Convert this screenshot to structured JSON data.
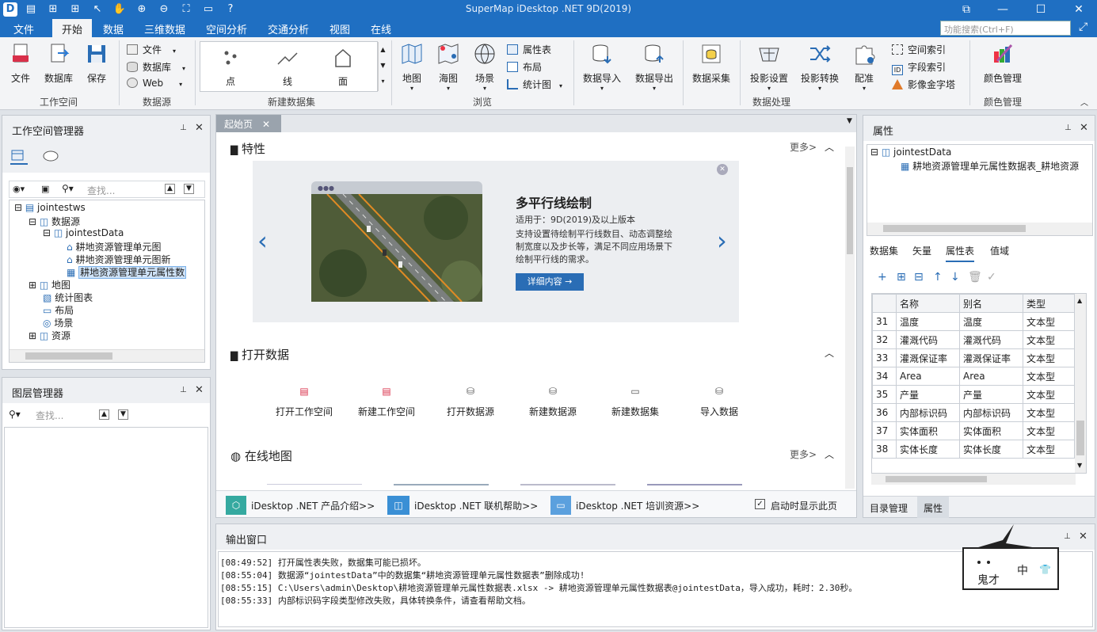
{
  "app_title": "SuperMap iDesktop .NET 9D(2019)",
  "menu": [
    "文件",
    "开始",
    "数据",
    "三维数据",
    "空间分析",
    "交通分析",
    "视图",
    "在线"
  ],
  "search_placeholder": "功能搜索(Ctrl+F)",
  "ribbon": {
    "workspace": {
      "items": [
        "文件",
        "数据库",
        "保存"
      ],
      "group": "工作空间"
    },
    "datasource": {
      "items": [
        "文件",
        "数据库",
        "Web"
      ],
      "group": "数据源"
    },
    "new_dataset": {
      "items": [
        "点",
        "线",
        "面"
      ],
      "group": "新建数据集"
    },
    "browse": {
      "items": [
        "地图",
        "海图",
        "场景"
      ],
      "small": [
        "属性表",
        "布局",
        "统计图"
      ],
      "group": "浏览"
    },
    "data_process": {
      "items": [
        "数据导入",
        "数据导出",
        "数据采集",
        "投影设置",
        "投影转换",
        "配准"
      ],
      "small": [
        "空间索引",
        "字段索引",
        "影像金字塔"
      ],
      "group": "数据处理"
    },
    "color": {
      "items": [
        "颜色管理"
      ],
      "group": "颜色管理"
    }
  },
  "workspace_manager": {
    "title": "工作空间管理器",
    "search_placeholder": "查找...",
    "tree": [
      "jointestws",
      "数据源",
      "jointestData",
      "耕地资源管理单元图",
      "耕地资源管理单元图新",
      "耕地资源管理单元属性数",
      "地图",
      "统计图表",
      "布局",
      "场景",
      "资源"
    ]
  },
  "layer_manager": {
    "title": "图层管理器",
    "search_placeholder": "查找..."
  },
  "start_page": {
    "tab": "起始页",
    "features": {
      "title": "特性",
      "more": "更多>"
    },
    "card": {
      "title": "多平行线绘制",
      "applies": "适用于：9D(2019)及以上版本",
      "desc": [
        "支持设置待绘制平行线数目、动态调整绘",
        "制宽度以及步长等，满足不同应用场景下",
        "绘制平行线的需求。"
      ],
      "button": "详细内容 →"
    },
    "open_data": {
      "title": "打开数据",
      "items": [
        "打开工作空间",
        "新建工作空间",
        "打开数据源",
        "新建数据源",
        "新建数据集",
        "导入数据"
      ]
    },
    "online_map": {
      "title": "在线地图",
      "more": "更多>"
    },
    "footer": {
      "links": [
        "iDesktop .NET 产品介绍>>",
        "iDesktop .NET 联机帮助>>",
        "iDesktop .NET 培训资源>>"
      ],
      "checkbox": "启动时显示此页"
    }
  },
  "properties": {
    "title": "属性",
    "tree": [
      "jointestData",
      "耕地资源管理单元属性数据表_耕地资源"
    ],
    "tabs": [
      "数据集",
      "矢量",
      "属性表",
      "值域"
    ],
    "columns": [
      "名称",
      "别名",
      "类型"
    ],
    "rows": [
      [
        "31",
        "温度",
        "温度",
        "文本型"
      ],
      [
        "32",
        "灌溉代码",
        "灌溉代码",
        "文本型"
      ],
      [
        "33",
        "灌溉保证率",
        "灌溉保证率",
        "文本型"
      ],
      [
        "34",
        "Area",
        "Area",
        "文本型"
      ],
      [
        "35",
        "产量",
        "产量",
        "文本型"
      ],
      [
        "36",
        "内部标识码",
        "内部标识码",
        "文本型"
      ],
      [
        "37",
        "实体面积",
        "实体面积",
        "文本型"
      ],
      [
        "38",
        "实体长度",
        "实体长度",
        "文本型"
      ]
    ],
    "bottom_tabs": [
      "目录管理",
      "属性"
    ]
  },
  "output": {
    "title": "输出窗口",
    "lines": [
      "[08:49:52] 打开属性表失败，数据集可能已损坏。",
      "[08:55:04] 数据源“jointestData”中的数据集“耕地资源管理单元属性数据表”删除成功!",
      "[08:55:15] C:\\Users\\admin\\Desktop\\耕地资源管理单元属性数据表.xlsx      -> 耕地资源管理单元属性数据表@jointestData，导入成功，耗时：2.30秒。",
      "[08:55:33] 内部标识码字段类型修改失败，具体转换条件，请查看帮助文档。"
    ]
  },
  "ime": {
    "name": "鬼才",
    "mode": "中"
  },
  "colors": {
    "accent": "#1f6fc2",
    "link_blue": "#2a6db5"
  }
}
